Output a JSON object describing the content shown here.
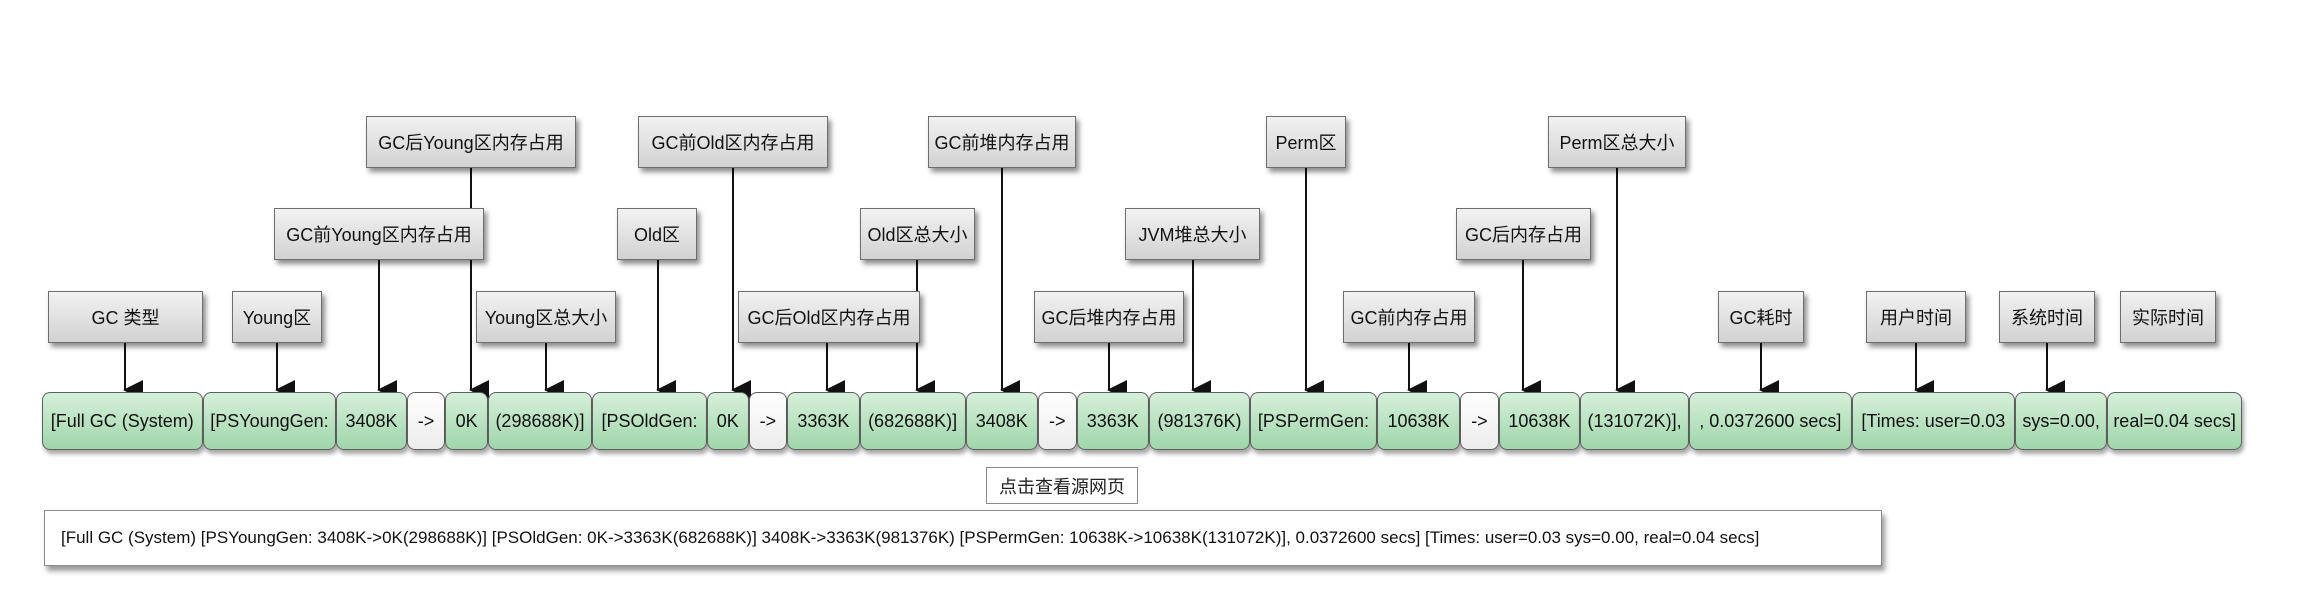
{
  "labels": {
    "gc_type": "GC 类型",
    "young_zone": "Young区",
    "young_before": "GC前Young区内存占用",
    "young_after": "GC后Young区内存占用",
    "young_total": "Young区总大小",
    "old_zone": "Old区",
    "old_before": "GC前Old区内存占用",
    "old_after": "GC后Old区内存占用",
    "old_total": "Old区总大小",
    "heap_before": "GC前堆内存占用",
    "heap_after": "GC后堆内存占用",
    "jvm_heap_total": "JVM堆总大小",
    "perm_zone": "Perm区",
    "perm_before": "GC前内存占用",
    "perm_after": "GC后内存占用",
    "perm_total": "Perm区总大小",
    "gc_time": "GC耗时",
    "user_time": "用户时间",
    "sys_time": "系统时间",
    "real_time": "实际时间"
  },
  "segments": [
    "[Full GC (System)",
    "[PSYoungGen:",
    "3408K",
    "->",
    "0K",
    "(298688K)]",
    "[PSOldGen:",
    "0K",
    "->",
    "3363K",
    "(682688K)]",
    "3408K",
    "->",
    "3363K",
    "(981376K)",
    "[PSPermGen:",
    "10638K",
    "->",
    "10638K",
    "(131072K)],",
    ", 0.0372600 secs]",
    "[Times: user=0.03",
    "sys=0.00,",
    "real=0.04 secs]"
  ],
  "view_source_link": "点击查看源网页",
  "full_log_line": "[Full GC (System) [PSYoungGen: 3408K->0K(298688K)] [PSOldGen: 0K->3363K(682688K)] 3408K->3363K(981376K) [PSPermGen: 10638K->10638K(131072K)], 0.0372600 secs] [Times: user=0.03 sys=0.00, real=0.04 secs]"
}
